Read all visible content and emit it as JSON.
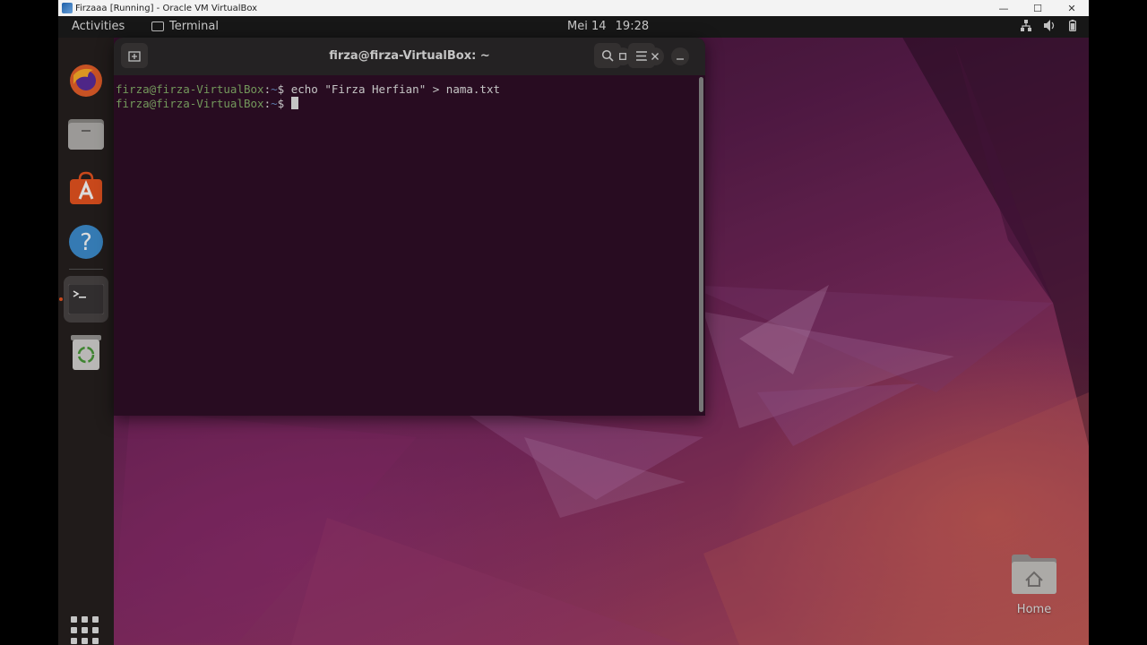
{
  "host_window": {
    "title": "Firzaaa [Running] - Oracle VM VirtualBox",
    "minimize_glyph": "—",
    "maximize_glyph": "☐",
    "close_glyph": "✕"
  },
  "top_panel": {
    "activities": "Activities",
    "app_menu": "Terminal",
    "clock_date": "Mei 14",
    "clock_time": "19:28",
    "tray_icons": [
      "network-icon",
      "volume-icon",
      "battery-icon"
    ]
  },
  "dock": {
    "items": [
      {
        "name": "Firefox",
        "icon": "firefox-icon"
      },
      {
        "name": "Files",
        "icon": "files-icon"
      },
      {
        "name": "Ubuntu Software",
        "icon": "software-icon"
      },
      {
        "name": "Help",
        "icon": "help-icon"
      },
      {
        "name": "Terminal",
        "icon": "terminal-icon",
        "active": true
      },
      {
        "name": "Trash",
        "icon": "trash-icon"
      }
    ],
    "show_apps_icon": "grid-icon"
  },
  "terminal": {
    "title": "firza@firza-VirtualBox: ~",
    "lines": [
      {
        "user": "firza@firza-VirtualBox",
        "sep": ":",
        "path": "~",
        "symbol": "$ ",
        "command": "echo \"Firza Herfian\" > nama.txt"
      },
      {
        "user": "firza@firza-VirtualBox",
        "sep": ":",
        "path": "~",
        "symbol": "$ ",
        "command": ""
      }
    ]
  },
  "desktop": {
    "home_label": "Home"
  },
  "colors": {
    "accent": "#e95420",
    "terminal_bg": "#2f0e27",
    "prompt_user": "#86b16b",
    "prompt_path": "#6b8fc7"
  }
}
